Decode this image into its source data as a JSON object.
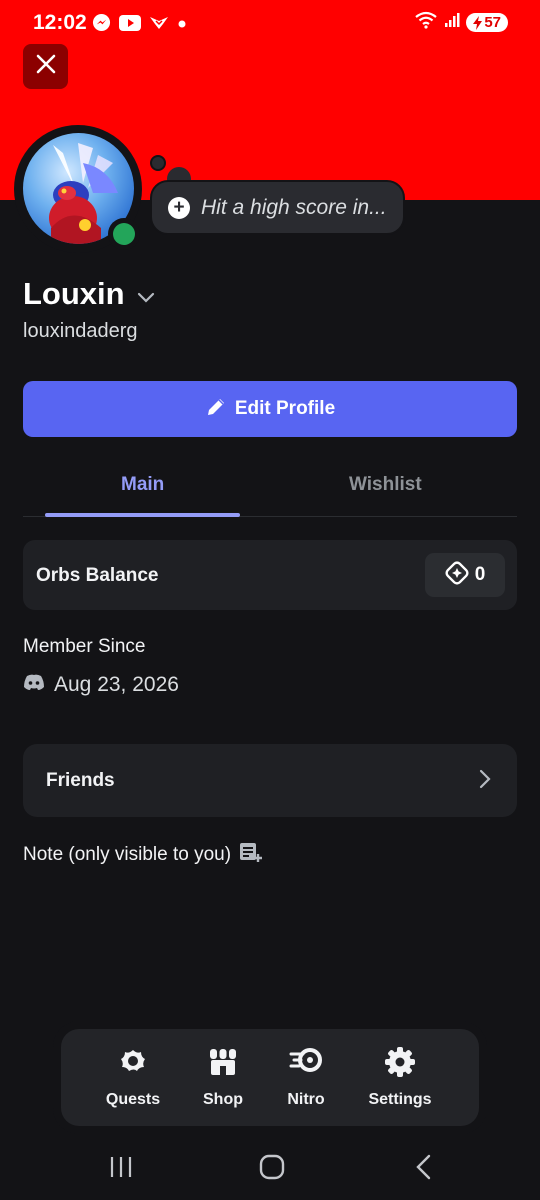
{
  "status_bar": {
    "time": "12:02",
    "battery": "57",
    "left_icons": [
      "messenger-icon",
      "youtube-icon",
      "app-icon",
      "dot-icon"
    ],
    "right_icons": [
      "wifi-icon",
      "signal-icon",
      "battery-icon"
    ]
  },
  "colors": {
    "banner": "#ff0000",
    "accent": "#5865f2",
    "tab_active": "#949cf7",
    "online": "#23a55a"
  },
  "profile": {
    "display_name": "Louxin",
    "username": "louxindaderg",
    "custom_status": "Hit a high score in...",
    "online_status": "online"
  },
  "actions": {
    "edit_profile_label": "Edit Profile"
  },
  "tabs": [
    {
      "label": "Main",
      "active": true
    },
    {
      "label": "Wishlist",
      "active": false
    }
  ],
  "orbs": {
    "label": "Orbs Balance",
    "value": "0"
  },
  "member_since": {
    "heading": "Member Since",
    "date": "Aug 23, 2026"
  },
  "friends": {
    "label": "Friends"
  },
  "note": {
    "label": "Note (only visible to you)"
  },
  "dock": [
    {
      "label": "Quests",
      "icon": "quests-icon"
    },
    {
      "label": "Shop",
      "icon": "shop-icon"
    },
    {
      "label": "Nitro",
      "icon": "nitro-icon"
    },
    {
      "label": "Settings",
      "icon": "gear-icon"
    }
  ],
  "nav_bar": [
    "recents-icon",
    "home-icon",
    "back-icon"
  ]
}
